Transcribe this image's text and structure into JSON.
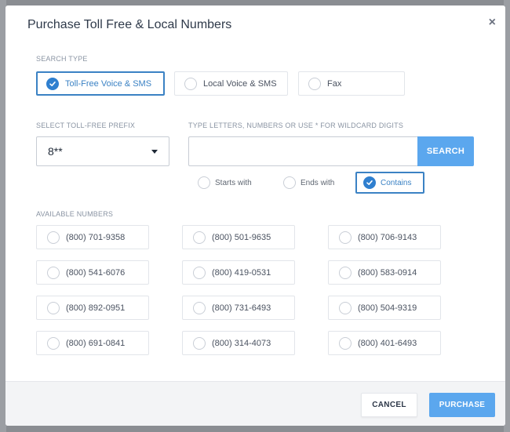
{
  "modal": {
    "title": "Purchase Toll Free & Local Numbers",
    "close_glyph": "×"
  },
  "search_type": {
    "label": "SEARCH TYPE",
    "options": [
      {
        "label": "Toll-Free Voice & SMS",
        "selected": true
      },
      {
        "label": "Local Voice & SMS",
        "selected": false
      },
      {
        "label": "Fax",
        "selected": false
      }
    ]
  },
  "prefix": {
    "label": "SELECT TOLL-FREE PREFIX",
    "value": "8**"
  },
  "search": {
    "label": "TYPE LETTERS, NUMBERS OR USE * FOR WILDCARD DIGITS",
    "value": "",
    "placeholder": "",
    "button_label": "SEARCH"
  },
  "match_options": [
    {
      "label": "Starts with",
      "selected": false
    },
    {
      "label": "Ends with",
      "selected": false
    },
    {
      "label": "Contains",
      "selected": true
    }
  ],
  "available": {
    "label": "AVAILABLE NUMBERS",
    "numbers": [
      "(800) 701-9358",
      "(800) 501-9635",
      "(800) 706-9143",
      "(800) 541-6076",
      "(800) 419-0531",
      "(800) 583-0914",
      "(800) 892-0951",
      "(800) 731-6493",
      "(800) 504-9319",
      "(800) 691-0841",
      "(800) 314-4073",
      "(800) 401-6493"
    ]
  },
  "footer": {
    "cancel_label": "CANCEL",
    "purchase_label": "PURCHASE"
  },
  "colors": {
    "accent": "#3b82c4",
    "button_blue": "#5ba7ee"
  }
}
